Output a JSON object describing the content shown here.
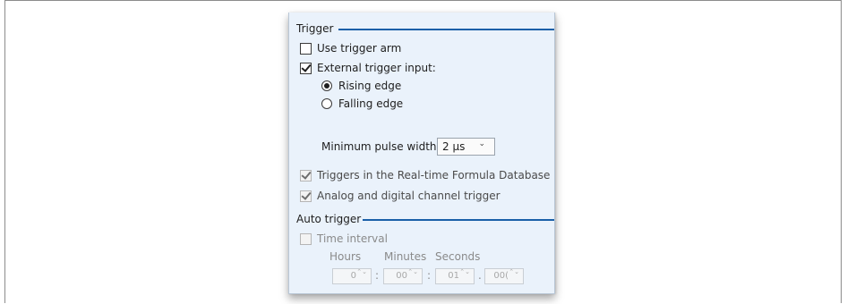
{
  "trigger": {
    "title": "Trigger",
    "use_trigger_arm": {
      "label": "Use trigger arm",
      "checked": false
    },
    "external_trigger_input": {
      "label": "External trigger input:",
      "checked": true
    },
    "rising_edge": {
      "label": "Rising edge",
      "selected": true
    },
    "falling_edge": {
      "label": "Falling edge",
      "selected": false
    },
    "min_pulse_width": {
      "label": "Minimum pulse width:",
      "value": "2 µs"
    },
    "formula_db_triggers": {
      "label": "Triggers in the Real-time Formula Database",
      "checked": true
    },
    "analog_digital_trigger": {
      "label": "Analog and digital channel trigger",
      "checked": true
    }
  },
  "auto_trigger": {
    "title": "Auto trigger",
    "time_interval": {
      "label": "Time interval",
      "checked": false
    },
    "headers": {
      "hours": "Hours",
      "minutes": "Minutes",
      "seconds": "Seconds"
    },
    "values": {
      "hours": "0",
      "minutes": "00",
      "seconds": "01",
      "fraction": "00("
    },
    "separators": {
      "colon": ":",
      "dot": "."
    },
    "spin_arrows": "⌃⌄"
  },
  "icons": {
    "dropdown": "chevron-down-icon",
    "spinner": "spinner-arrows-icon"
  },
  "colors": {
    "accent": "#1a5fa8",
    "panel_bg": "#eaf2fb"
  }
}
